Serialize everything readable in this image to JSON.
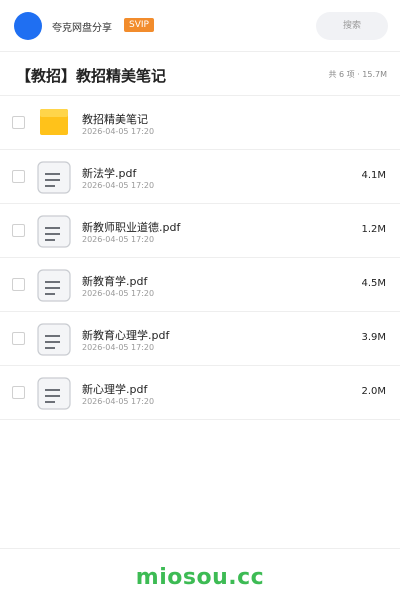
{
  "header": {
    "user_name": "夸克网盘分享",
    "badge": "SVIP",
    "search_placeholder": "搜索",
    "avatar_color": "#1f6ff2",
    "badge_color": "#f28c2c"
  },
  "folder": {
    "title": "【教招】教招精美笔记",
    "summary": "共 6 项 · 15.7M"
  },
  "files": [
    {
      "name": "教招精美笔记",
      "date": "2026-04-05 17:20",
      "size": "",
      "type": "folder-icon"
    },
    {
      "name": "新法学.pdf",
      "date": "2026-04-05 17:20",
      "size": "4.1M",
      "type": "document-icon"
    },
    {
      "name": "新教师职业道德.pdf",
      "date": "2026-04-05 17:20",
      "size": "1.2M",
      "type": "document-icon"
    },
    {
      "name": "新教育学.pdf",
      "date": "2026-04-05 17:20",
      "size": "4.5M",
      "type": "document-icon"
    },
    {
      "name": "新教育心理学.pdf",
      "date": "2026-04-05 17:20",
      "size": "3.9M",
      "type": "document-icon"
    },
    {
      "name": "新心理学.pdf",
      "date": "2026-04-05 17:20",
      "size": "2.0M",
      "type": "document-icon"
    }
  ],
  "footer": {
    "brand": "miosou.cc",
    "brand_color": "#3dbb54"
  }
}
